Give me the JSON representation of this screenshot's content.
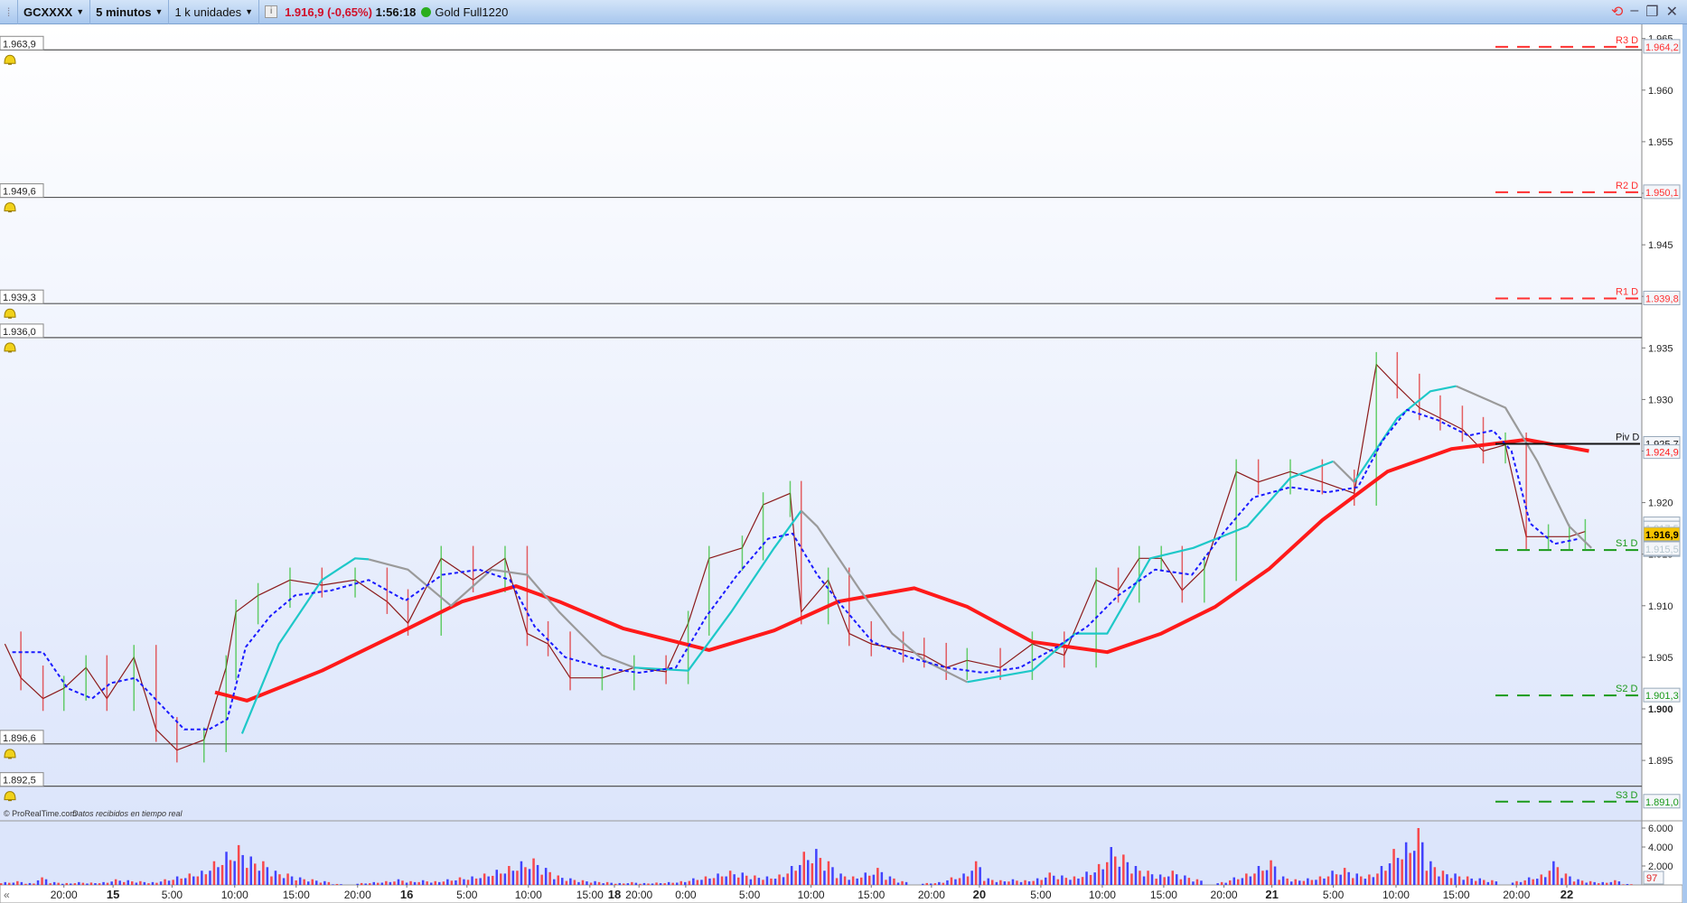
{
  "toolbar": {
    "instrument": "GCXXXX",
    "timeframe": "5 minutos",
    "units": "1 k unidades",
    "price_change": "1.916,9 (-0,65%)",
    "time": "1:56:18",
    "feed_name": "Gold Full1220",
    "info_icon": "i"
  },
  "footer": {
    "copyright": "© ProRealTime.com",
    "status": "Datos recibidos en tiempo real",
    "scroll_left": "«"
  },
  "colors": {
    "up": "#2cbf2c",
    "down": "#e02020",
    "price_line": "#8b1a1a",
    "ma": "#ff1a1a",
    "cyan": "#1ec8c8",
    "grey": "#9a9a9a",
    "dotted": "#1a1aff",
    "pivot_r": "#ff3030",
    "pivot_s": "#1a9a1a"
  },
  "chart_data": {
    "type": "line",
    "title": "GCXXXX 5 minutos",
    "xlabel": "",
    "ylabel": "",
    "x_unit": "hours since chart start",
    "xlim": [
      0,
      133
    ],
    "ylim": [
      1889.5,
      1967
    ],
    "price_ticks": [
      "1.965",
      "1.960",
      "1.955",
      "1.950",
      "1.945",
      "1.940",
      "1.935",
      "1.930",
      "1.925",
      "1.920",
      "1.915",
      "1.910",
      "1.905",
      "1.900",
      "1.895"
    ],
    "price_tick_values": [
      1965,
      1960,
      1955,
      1950,
      1945,
      1940,
      1935,
      1930,
      1925,
      1920,
      1915,
      1910,
      1905,
      1900,
      1895
    ],
    "time_ticks": [
      {
        "h": 5.2,
        "label": "20:00"
      },
      {
        "h": 9.2,
        "label": "15",
        "bold": true
      },
      {
        "h": 14,
        "label": "5:00"
      },
      {
        "h": 19.1,
        "label": "10:00"
      },
      {
        "h": 24.1,
        "label": "15:00"
      },
      {
        "h": 29.1,
        "label": "20:00"
      },
      {
        "h": 33.1,
        "label": "16",
        "bold": true
      },
      {
        "h": 38,
        "label": "5:00"
      },
      {
        "h": 43,
        "label": "10:00"
      },
      {
        "h": 48,
        "label": "15:00"
      },
      {
        "h": 50,
        "label": "18",
        "bold": true
      },
      {
        "h": 52,
        "label": "20:00"
      },
      {
        "h": 55.8,
        "label": "0:00"
      },
      {
        "h": 61,
        "label": "5:00"
      },
      {
        "h": 66,
        "label": "10:00"
      },
      {
        "h": 70.9,
        "label": "15:00"
      },
      {
        "h": 75.8,
        "label": "20:00"
      },
      {
        "h": 79.7,
        "label": "20",
        "bold": true
      },
      {
        "h": 84.7,
        "label": "5:00"
      },
      {
        "h": 89.7,
        "label": "10:00"
      },
      {
        "h": 94.7,
        "label": "15:00"
      },
      {
        "h": 99.6,
        "label": "20:00"
      },
      {
        "h": 103.5,
        "label": "21",
        "bold": true
      },
      {
        "h": 108.5,
        "label": "5:00"
      },
      {
        "h": 113.6,
        "label": "10:00"
      },
      {
        "h": 118.5,
        "label": "15:00"
      },
      {
        "h": 123.4,
        "label": "20:00"
      },
      {
        "h": 127.5,
        "label": "22",
        "bold": true
      }
    ],
    "series": [
      {
        "name": "Price",
        "color_key": "price_line",
        "points": [
          [
            0.4,
            1906.3
          ],
          [
            1.7,
            1903
          ],
          [
            3.5,
            1901
          ],
          [
            5.2,
            1902
          ],
          [
            7,
            1904
          ],
          [
            8.7,
            1901
          ],
          [
            10.9,
            1905
          ],
          [
            12.7,
            1898
          ],
          [
            14.4,
            1896
          ],
          [
            16.6,
            1897
          ],
          [
            18.4,
            1904
          ],
          [
            19.2,
            1909.4
          ],
          [
            21,
            1911
          ],
          [
            23.6,
            1912.5
          ],
          [
            26.2,
            1912
          ],
          [
            28.9,
            1912.5
          ],
          [
            31.5,
            1910.4
          ],
          [
            33.2,
            1908.3
          ],
          [
            35.9,
            1914.6
          ],
          [
            38.5,
            1912.5
          ],
          [
            41.1,
            1914.6
          ],
          [
            42.9,
            1907.3
          ],
          [
            44.6,
            1906.3
          ],
          [
            46.4,
            1903
          ],
          [
            49,
            1903
          ],
          [
            51.6,
            1904
          ],
          [
            54.2,
            1903.6
          ],
          [
            56,
            1908.3
          ],
          [
            57.7,
            1914.6
          ],
          [
            60.4,
            1915.6
          ],
          [
            62.1,
            1919.8
          ],
          [
            64.3,
            1920.9
          ],
          [
            65.2,
            1909.4
          ],
          [
            67.4,
            1912.5
          ],
          [
            69.1,
            1907.3
          ],
          [
            70.9,
            1906.3
          ],
          [
            73.5,
            1905.7
          ],
          [
            75.2,
            1905.2
          ],
          [
            77,
            1904
          ],
          [
            78.7,
            1904.7
          ],
          [
            81.4,
            1904
          ],
          [
            84,
            1906.3
          ],
          [
            86.6,
            1905.2
          ],
          [
            89.2,
            1912.5
          ],
          [
            91,
            1911.5
          ],
          [
            92.7,
            1914.6
          ],
          [
            94.5,
            1914.6
          ],
          [
            96.2,
            1911.5
          ],
          [
            98,
            1913.6
          ],
          [
            100.6,
            1923
          ],
          [
            102.4,
            1922
          ],
          [
            105,
            1923
          ],
          [
            107.6,
            1922
          ],
          [
            110.2,
            1920.9
          ],
          [
            112,
            1933.4
          ],
          [
            113.7,
            1931.3
          ],
          [
            115.5,
            1929.2
          ],
          [
            117.2,
            1928.2
          ],
          [
            119,
            1927.1
          ],
          [
            120.7,
            1925
          ],
          [
            122.5,
            1925.6
          ],
          [
            124.2,
            1916.7
          ],
          [
            126,
            1916.7
          ],
          [
            127.7,
            1916.7
          ],
          [
            129,
            1917.2
          ]
        ]
      },
      {
        "name": "Moving average",
        "color_key": "ma",
        "points": [
          [
            17.5,
            1901.6
          ],
          [
            20.1,
            1900.8
          ],
          [
            26.2,
            1903.7
          ],
          [
            32.4,
            1907.3
          ],
          [
            37.6,
            1910.4
          ],
          [
            42,
            1911.9
          ],
          [
            45.5,
            1910.4
          ],
          [
            50.7,
            1907.8
          ],
          [
            57.7,
            1905.7
          ],
          [
            63,
            1907.6
          ],
          [
            68.2,
            1910.4
          ],
          [
            74.4,
            1911.7
          ],
          [
            78.7,
            1909.9
          ],
          [
            84,
            1906.5
          ],
          [
            90.1,
            1905.5
          ],
          [
            94.5,
            1907.3
          ],
          [
            98.9,
            1909.9
          ],
          [
            103.3,
            1913.6
          ],
          [
            107.6,
            1918.3
          ],
          [
            112.9,
            1923
          ],
          [
            118.1,
            1925.2
          ],
          [
            124.2,
            1926.1
          ],
          [
            129.3,
            1925
          ]
        ]
      },
      {
        "name": "Trend up",
        "color_key": "cyan",
        "points": [
          [
            19.7,
            1897.6
          ],
          [
            22.7,
            1906.3
          ],
          [
            26.2,
            1912.5
          ],
          [
            28.9,
            1914.6
          ],
          [
            30,
            1914.5
          ],
          null,
          [
            51.6,
            1904
          ],
          [
            56,
            1903.7
          ],
          [
            59.5,
            1909.4
          ],
          [
            63,
            1915.6
          ],
          [
            65.2,
            1919.2
          ],
          null,
          [
            78.7,
            1902.6
          ],
          [
            84,
            1903.7
          ],
          [
            87.5,
            1907.3
          ],
          [
            90.1,
            1907.3
          ],
          [
            93.6,
            1914.6
          ],
          [
            97.1,
            1915.6
          ],
          [
            101.5,
            1917.7
          ],
          [
            105,
            1922.4
          ],
          [
            108.5,
            1924
          ],
          null,
          [
            110.2,
            1922
          ],
          [
            113.7,
            1928.2
          ],
          [
            116.4,
            1930.8
          ],
          [
            118.5,
            1931.3
          ]
        ]
      },
      {
        "name": "Trend down",
        "color_key": "grey",
        "points": [
          [
            30,
            1914.5
          ],
          [
            33.2,
            1913.5
          ],
          [
            36.7,
            1910
          ],
          [
            40,
            1913.5
          ],
          [
            42.9,
            1913
          ],
          [
            45.5,
            1909.4
          ],
          [
            49,
            1905.2
          ],
          [
            51.6,
            1904
          ],
          null,
          [
            65.2,
            1919.2
          ],
          [
            66.5,
            1917.7
          ],
          [
            70,
            1911.5
          ],
          [
            72.6,
            1907.3
          ],
          [
            75.2,
            1904.7
          ],
          [
            78.7,
            1902.6
          ],
          null,
          [
            108.5,
            1924
          ],
          [
            110.2,
            1922
          ],
          null,
          [
            118.5,
            1931.3
          ],
          [
            122.5,
            1929.2
          ],
          [
            125.1,
            1924
          ],
          [
            127.7,
            1917.7
          ],
          [
            129.5,
            1915.6
          ]
        ]
      },
      {
        "name": "Dotted average",
        "color_key": "dotted",
        "points": [
          [
            1,
            1905.5
          ],
          [
            3.5,
            1905.5
          ],
          [
            5.5,
            1902
          ],
          [
            7.5,
            1901
          ],
          [
            9,
            1902.5
          ],
          [
            11,
            1903
          ],
          [
            13,
            1900.5
          ],
          [
            15,
            1898
          ],
          [
            17,
            1898
          ],
          [
            18.5,
            1899
          ],
          [
            20,
            1906
          ],
          [
            22,
            1909
          ],
          [
            24,
            1911
          ],
          [
            27,
            1911.5
          ],
          [
            30,
            1912.5
          ],
          [
            33,
            1910.5
          ],
          [
            36,
            1913
          ],
          [
            39,
            1913.5
          ],
          [
            41.5,
            1912.5
          ],
          [
            43.5,
            1908
          ],
          [
            46,
            1905
          ],
          [
            49,
            1904
          ],
          [
            52,
            1903.5
          ],
          [
            55,
            1904
          ],
          [
            57.5,
            1909
          ],
          [
            60,
            1913
          ],
          [
            62.5,
            1916.5
          ],
          [
            64.5,
            1917
          ],
          [
            66.5,
            1913
          ],
          [
            68.5,
            1910
          ],
          [
            71,
            1906.5
          ],
          [
            74,
            1905
          ],
          [
            77,
            1904
          ],
          [
            80,
            1903.5
          ],
          [
            83,
            1904
          ],
          [
            86,
            1906
          ],
          [
            88.5,
            1908
          ],
          [
            91,
            1911
          ],
          [
            94,
            1913.5
          ],
          [
            97,
            1913
          ],
          [
            99.5,
            1917
          ],
          [
            102,
            1920.5
          ],
          [
            105,
            1921.5
          ],
          [
            108,
            1921
          ],
          [
            110.5,
            1921.5
          ],
          [
            112.5,
            1926
          ],
          [
            114.5,
            1929
          ],
          [
            117,
            1928
          ],
          [
            119.5,
            1926.5
          ],
          [
            121.5,
            1927
          ],
          [
            123,
            1925
          ],
          [
            124.5,
            1918
          ],
          [
            126.5,
            1916
          ],
          [
            128.5,
            1916.5
          ]
        ]
      }
    ],
    "alert_lines": [
      {
        "value": 1963.9,
        "label": "1.963,9"
      },
      {
        "value": 1949.6,
        "label": "1.949,6"
      },
      {
        "value": 1939.3,
        "label": "1.939,3"
      },
      {
        "value": 1936.0,
        "label": "1.936,0"
      },
      {
        "value": 1896.6,
        "label": "1.896,6"
      },
      {
        "value": 1892.5,
        "label": "1.892,5"
      }
    ],
    "pivots": [
      {
        "name": "R3 D",
        "value": 1964.2,
        "label": "1.964,2",
        "kind": "r"
      },
      {
        "name": "R2 D",
        "value": 1950.1,
        "label": "1.950,1",
        "kind": "r"
      },
      {
        "name": "R1 D",
        "value": 1939.8,
        "label": "1.939,8",
        "kind": "r"
      },
      {
        "name": "Piv D",
        "value": 1925.7,
        "label": "1.925,7",
        "kind": "p"
      },
      {
        "name": "S1 D",
        "value": 1915.4,
        "label": "1.915,4",
        "kind": "s"
      },
      {
        "name": "S2 D",
        "value": 1901.3,
        "label": "1.901,3",
        "kind": "s"
      },
      {
        "name": "S3 D",
        "value": 1891.0,
        "label": "1.891,0",
        "kind": "s"
      }
    ],
    "axis_tags": [
      {
        "value": 1924.9,
        "label": "1.924,9",
        "style": "ma"
      },
      {
        "value": 1917.9,
        "label": "1.917,9",
        "style": "faint"
      },
      {
        "value": 1917.5,
        "label": "1.917,5",
        "style": "faint"
      },
      {
        "value": 1916.9,
        "label": "1.916,9",
        "style": "current"
      },
      {
        "value": 1915.5,
        "label": "1.915,5",
        "style": "faint"
      }
    ],
    "volume": {
      "ticks": [
        {
          "value": 6000,
          "label": "6.000"
        },
        {
          "value": 4000,
          "label": "4.000"
        },
        {
          "value": 2000,
          "label": "2.000"
        }
      ],
      "current": "97",
      "hourly": [
        300,
        400,
        200,
        800,
        300,
        200,
        300,
        250,
        300,
        600,
        500,
        400,
        300,
        600,
        900,
        1200,
        1500,
        2500,
        3500,
        4200,
        3000,
        2500,
        1500,
        1200,
        800,
        600,
        400,
        100,
        0,
        200,
        300,
        400,
        600,
        400,
        500,
        400,
        600,
        800,
        900,
        1200,
        1600,
        2000,
        2500,
        2800,
        1800,
        1000,
        700,
        500,
        400,
        300,
        200,
        300,
        200,
        250,
        300,
        400,
        700,
        900,
        1200,
        1500,
        1300,
        1000,
        900,
        1100,
        2000,
        3500,
        3800,
        2500,
        1200,
        900,
        1300,
        1800,
        900,
        400,
        0,
        200,
        300,
        800,
        1200,
        2500,
        700,
        500,
        600,
        500,
        700,
        1300,
        1000,
        900,
        1400,
        2200,
        4000,
        3200,
        2000,
        1500,
        1100,
        1500,
        1000,
        600,
        0,
        300,
        800,
        1200,
        2000,
        2600,
        900,
        600,
        700,
        900,
        1500,
        1800,
        1200,
        1100,
        2000,
        3800,
        4500,
        6000,
        2500,
        1500,
        1200,
        900,
        700,
        500,
        0,
        400,
        800,
        1100,
        2500,
        1200,
        600,
        400,
        300,
        500,
        97
      ]
    }
  }
}
